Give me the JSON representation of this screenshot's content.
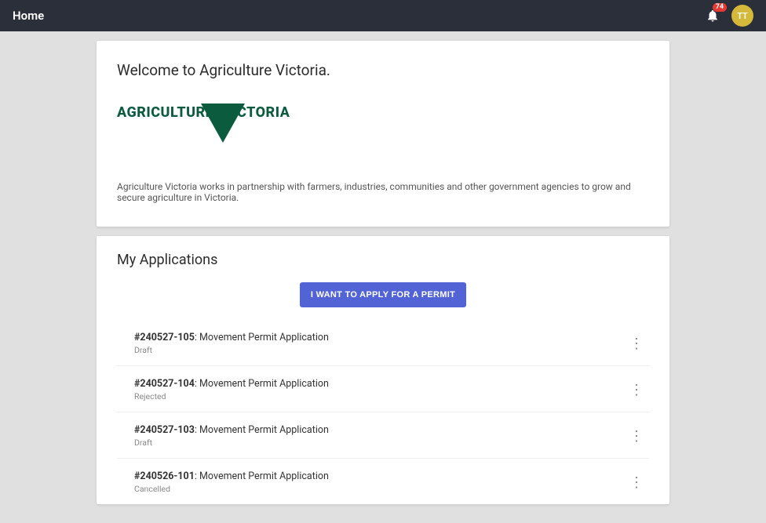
{
  "topbar": {
    "title": "Home",
    "notif_count": "74",
    "avatar_initials": "TT"
  },
  "welcome": {
    "heading": "Welcome to Agriculture Victoria.",
    "logo_a": "AGRICULTURE",
    "logo_b": "ICTORIA",
    "body": "Agriculture Victoria works in partnership with farmers, industries, communities and other government agencies to grow and secure agriculture in Victoria."
  },
  "apps": {
    "heading": "My Applications",
    "apply_label": "I WANT TO APPLY FOR A PERMIT",
    "sep": ": ",
    "rows": [
      {
        "id": "#240527-105",
        "title": "Movement Permit Application",
        "status": "Draft"
      },
      {
        "id": "#240527-104",
        "title": "Movement Permit Application",
        "status": "Rejected"
      },
      {
        "id": "#240527-103",
        "title": "Movement Permit Application",
        "status": "Draft"
      },
      {
        "id": "#240526-101",
        "title": "Movement Permit Application",
        "status": "Cancelled"
      }
    ]
  }
}
